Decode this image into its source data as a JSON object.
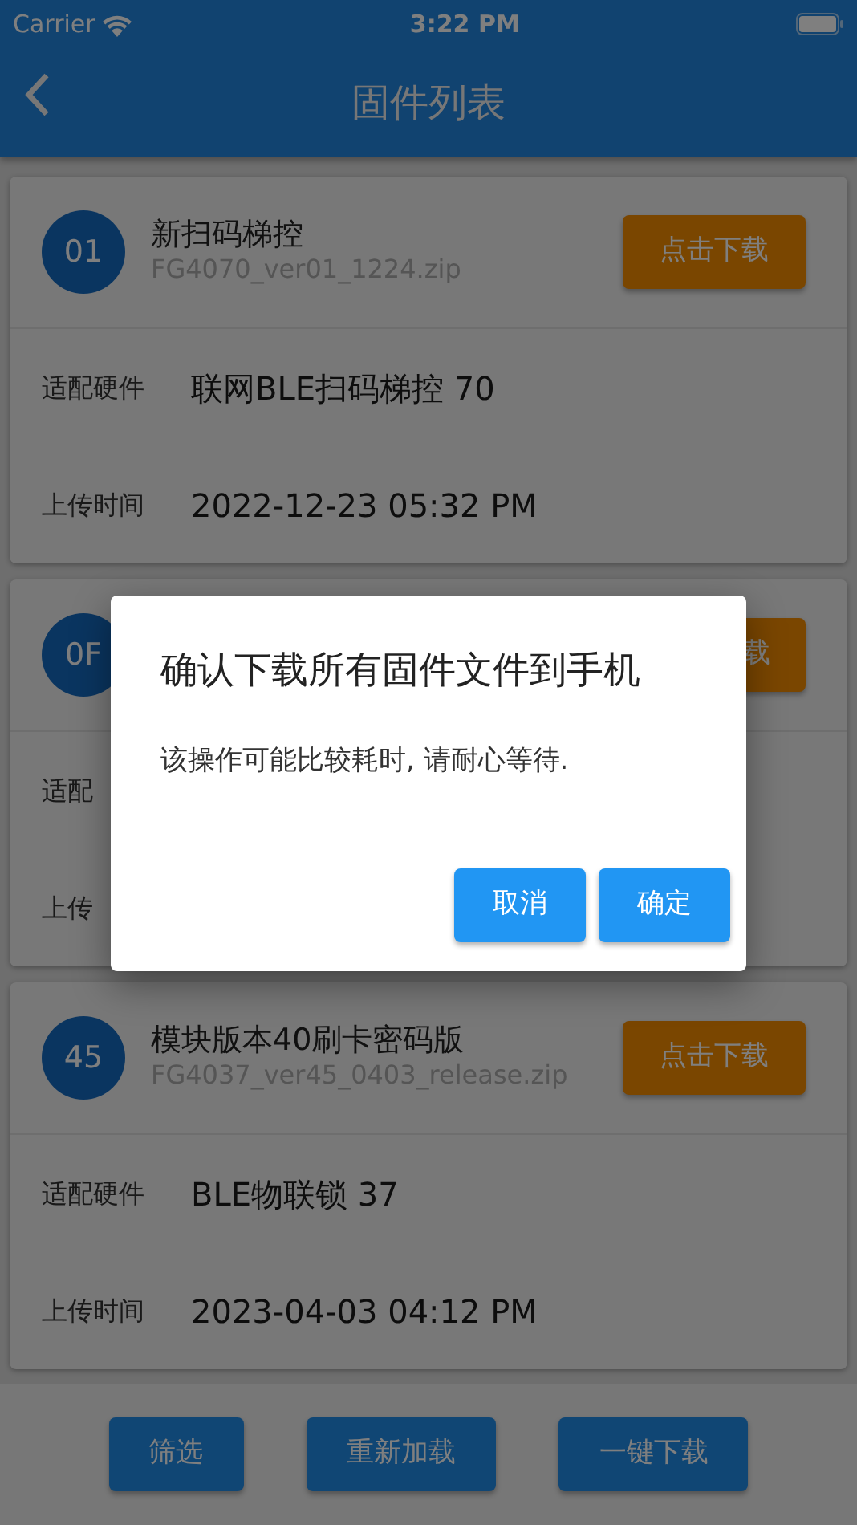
{
  "status_bar": {
    "carrier": "Carrier",
    "time": "3:22 PM"
  },
  "nav_bar": {
    "title": "固件列表"
  },
  "firmware_list": [
    {
      "badge": "01",
      "name": "新扫码梯控",
      "file": "FG4070_ver01_1224.zip",
      "button": "点击下载",
      "details": [
        {
          "label": "适配硬件",
          "value": "联网BLE扫码梯控 70"
        },
        {
          "label": "上传时间",
          "value": "2022-12-23 05:32 PM"
        }
      ]
    },
    {
      "badge": "0F",
      "button": "载",
      "details": [
        {
          "label": "适配"
        },
        {
          "label": "上传"
        }
      ]
    },
    {
      "badge": "45",
      "name": "模块版本40刷卡密码版",
      "file": "FG4037_ver45_0403_release.zip",
      "button": "点击下载",
      "details": [
        {
          "label": "适配硬件",
          "value": "BLE物联锁 37"
        },
        {
          "label": "上传时间",
          "value": "2023-04-03 04:12 PM"
        }
      ]
    }
  ],
  "bottom_buttons": [
    "筛选",
    "重新加载",
    "一键下载"
  ],
  "dialog": {
    "title": "确认下载所有固件文件到手机",
    "message": "该操作可能比较耗时, 请耐心等待.",
    "buttons": [
      "取消",
      "确定"
    ]
  }
}
